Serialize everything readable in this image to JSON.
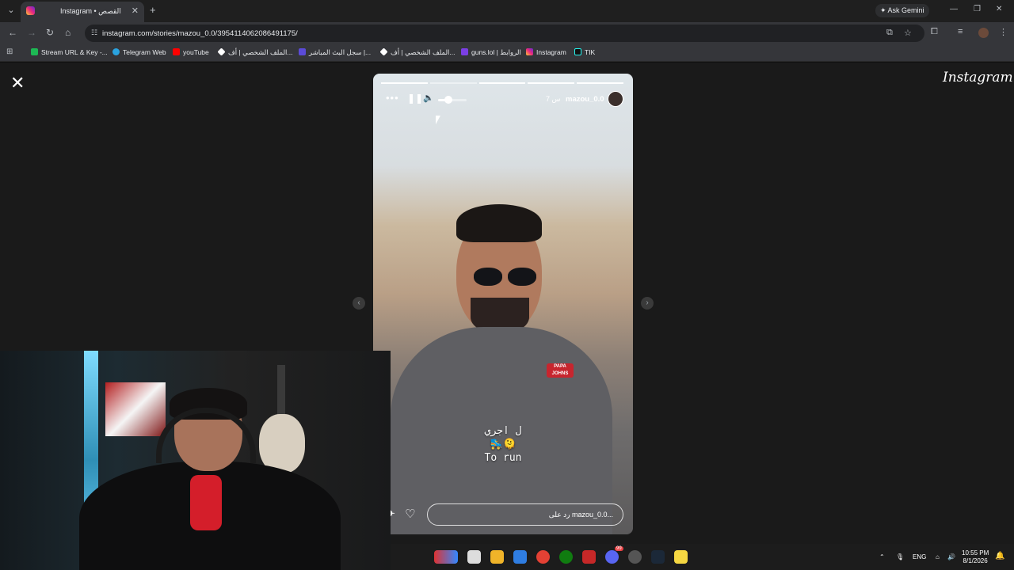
{
  "browser": {
    "tab_title": "Instagram • القصص",
    "url": "instagram.com/stories/mazou_0.0/3954114062086491175/",
    "ask_gemini": "Ask Gemini"
  },
  "bookmarks": [
    {
      "label": "Stream URL & Key -...",
      "color": "#1db954"
    },
    {
      "label": "Telegram Web",
      "color": "#2aa3e0"
    },
    {
      "label": "youTube",
      "color": "#ff0000"
    },
    {
      "label": "الملف الشخصي | أف...",
      "color": "#ffffff"
    },
    {
      "label": "سجل البث المباشر |...",
      "color": "#5b4bd8"
    },
    {
      "label": "الملف الشخصي | أف...",
      "color": "#ffffff"
    },
    {
      "label": "guns.lol | الروابط",
      "color": "#7b3fe4"
    },
    {
      "label": "Instagram",
      "color": "#e1306c"
    },
    {
      "label": "TIK",
      "color": "#000000"
    }
  ],
  "story": {
    "username": "mazou_0.0",
    "time_ago": "7 س",
    "caption_line1": "ل اجري",
    "caption_emoji": "🛼🫠",
    "caption_line2": "To run",
    "reply_placeholder": "رد على mazou_0.0...",
    "shirt_logo": "PAPA JOHNS",
    "segments": [
      true,
      false,
      true,
      true,
      true
    ],
    "volume_level": 0.35
  },
  "viewer": {
    "logo": "Instagram"
  },
  "taskbar": {
    "lang": "ENG",
    "time": "10:55 PM",
    "date": "8/1/2026",
    "discord_badge": "99"
  }
}
